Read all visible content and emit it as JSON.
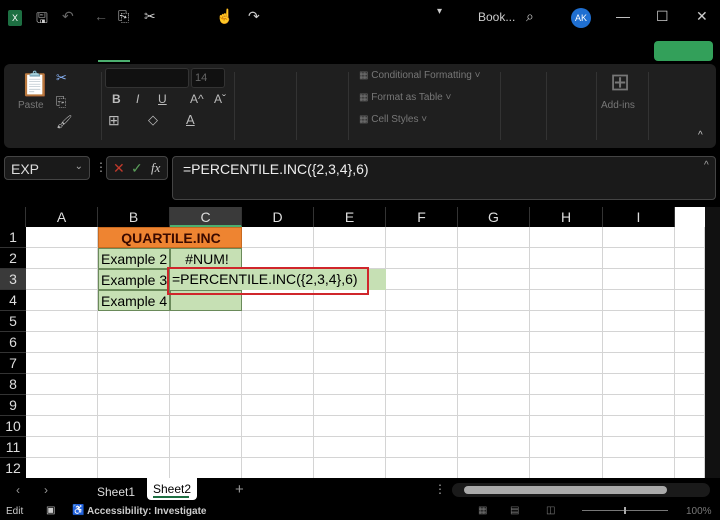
{
  "titlebar": {
    "title": "Book...",
    "avatar": "AK",
    "icons": [
      "excel-logo-icon",
      "save-icon",
      "undo-icon",
      "back-icon",
      "copy-icon",
      "cut-icon",
      "sign-icon",
      "spelling-icon",
      "touch-mode-icon",
      "redo-icon",
      "new-file-icon",
      "strikethrough-icon",
      "camera-icon",
      "form-icon",
      "shape-icon",
      "accessibility-icon",
      "record-icon",
      "customize-icon"
    ]
  },
  "ribbon": {
    "paste": "Paste",
    "font_size": "14",
    "bold": "B",
    "italic": "I",
    "underline": "U",
    "grow": "A^",
    "shrink": "Aˇ",
    "conditional_formatting": "Conditional Formatting",
    "format_as_table": "Format as Table",
    "cell_styles": "Cell Styles",
    "addins": "Add-ins"
  },
  "formula_bar": {
    "name_box": "EXP",
    "fx": "fx",
    "formula": "=PERCENTILE.INC({2,3,4},6)"
  },
  "columns": [
    "A",
    "B",
    "C",
    "D",
    "E",
    "F",
    "G",
    "H",
    "I"
  ],
  "rows": [
    "1",
    "2",
    "3",
    "4",
    "5",
    "6",
    "7",
    "8",
    "9",
    "10",
    "11",
    "12"
  ],
  "cells": {
    "title": "QUARTILE.INC",
    "b2": "Example 2",
    "c2": "#NUM!",
    "b3": "Example 3",
    "c3": "=PERCENTILE.INC({2,3,4},6)",
    "b4": "Example 4"
  },
  "colors": {
    "header_orange": "#ee8431",
    "cell_green": "#c6e0b4",
    "highlight_border": "#d0262b",
    "accent": "#33a05a"
  },
  "sheets": [
    "Sheet1",
    "Sheet2"
  ],
  "active_sheet": "Sheet2",
  "status": {
    "mode": "Edit",
    "accessibility": "Accessibility: Investigate",
    "zoom": "100%"
  }
}
